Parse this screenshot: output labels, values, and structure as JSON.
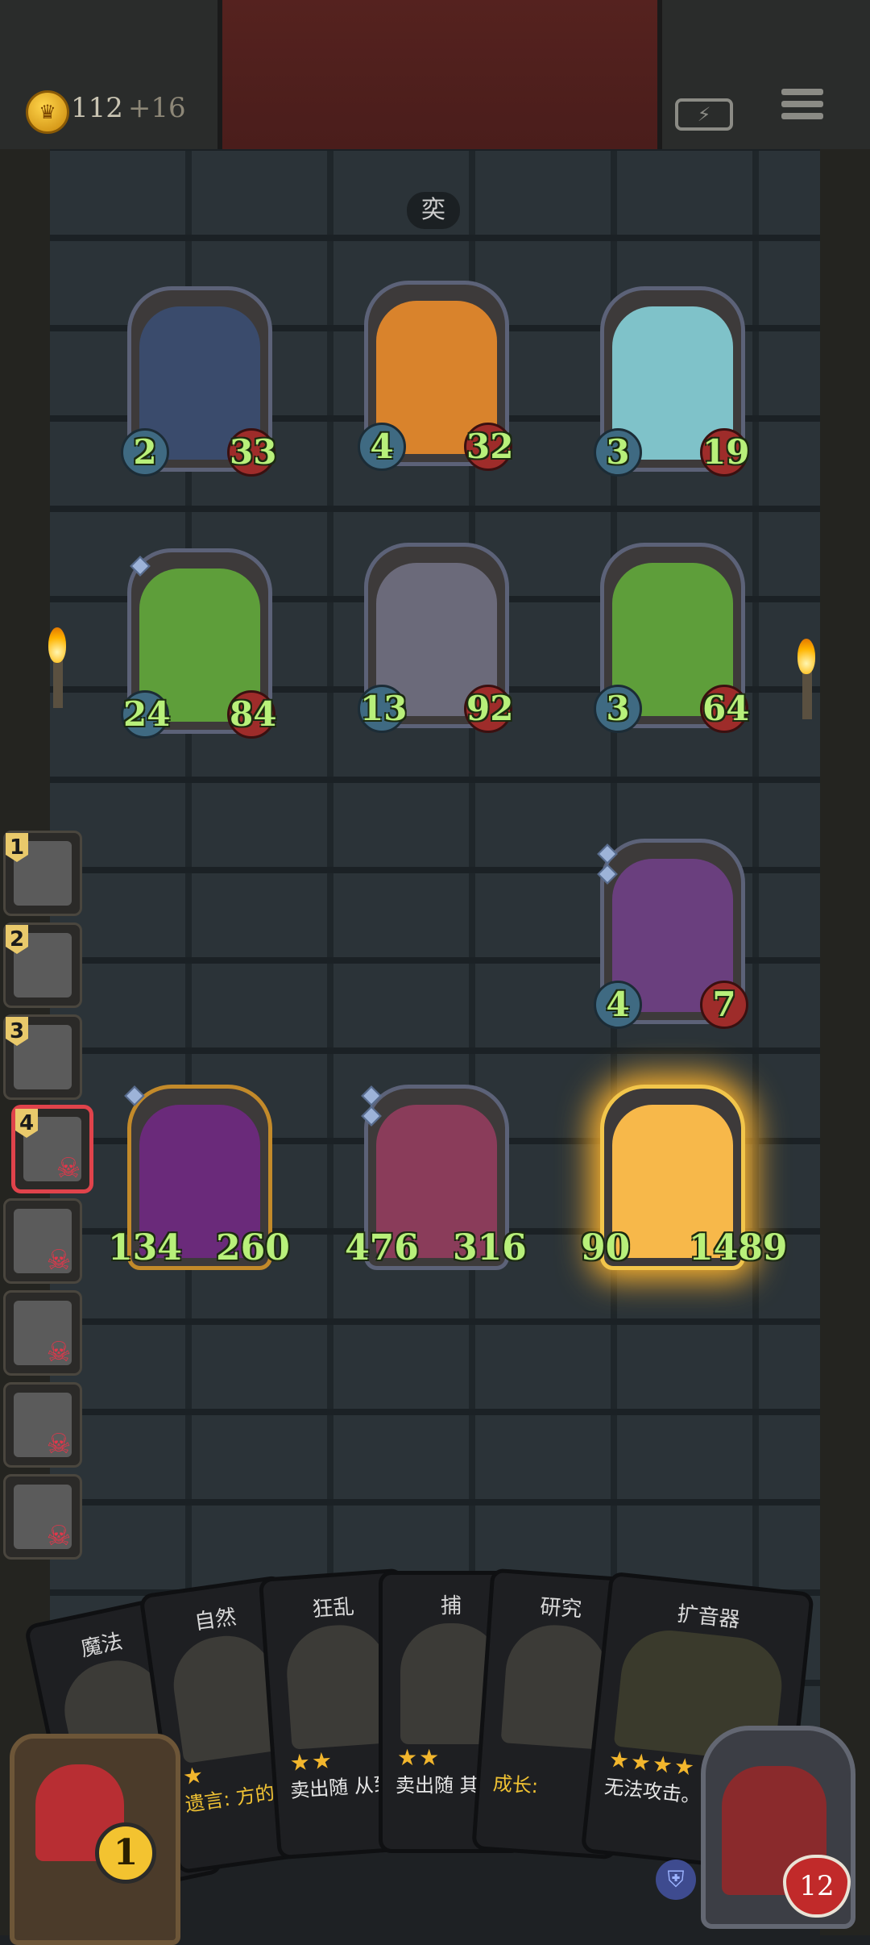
{
  "header": {
    "coins": "112",
    "coin_income": "+16",
    "coin_icon": "crown-coin-icon",
    "battery_icon": "battery-charging-icon",
    "menu_icon": "menu-icon"
  },
  "round_label": "奕",
  "board": {
    "units": [
      {
        "name": "elf-sorceress",
        "atk": "2",
        "hp": "33",
        "color": "#3a4b6c"
      },
      {
        "name": "pumpkin-ghost",
        "atk": "4",
        "hp": "32",
        "color": "#d9832c"
      },
      {
        "name": "fairy",
        "atk": "3",
        "hp": "19",
        "color": "#7fc2c9"
      },
      {
        "name": "leaf-sprout",
        "atk": "24",
        "hp": "84",
        "color": "#5e9e3a"
      },
      {
        "name": "mushroom-beast",
        "atk": "13",
        "hp": "92",
        "color": "#6b6a7a"
      },
      {
        "name": "leaf-sprout",
        "atk": "3",
        "hp": "64",
        "color": "#5e9e3a"
      },
      {
        "name": "elf-sorceress",
        "atk": "4",
        "hp": "7",
        "color": "#6a3f7e"
      },
      {
        "name": "jester-clown",
        "atk": "134",
        "hp": "260",
        "color": "#6a2a7a"
      },
      {
        "name": "grinning-imp",
        "atk": "476",
        "hp": "316",
        "color": "#8a3c5a"
      },
      {
        "name": "glowing-sprout",
        "atk": "90",
        "hp": "1489",
        "color": "#f7b84a"
      }
    ]
  },
  "opponents": [
    {
      "rank": "1",
      "status": "alive"
    },
    {
      "rank": "2",
      "status": "alive"
    },
    {
      "rank": "3",
      "status": "alive"
    },
    {
      "rank": "4",
      "status": "eliminated"
    },
    {
      "rank": "",
      "status": "eliminated"
    },
    {
      "rank": "",
      "status": "eliminated"
    },
    {
      "rank": "",
      "status": "eliminated"
    },
    {
      "rank": "",
      "status": "eliminated"
    }
  ],
  "hand": [
    {
      "title": "魔法",
      "stars": "",
      "desc": ""
    },
    {
      "title": "自然",
      "stars": "★",
      "desc": "遗言: 方的",
      "kw": "遗言"
    },
    {
      "title": "狂乱",
      "stars": "★★",
      "desc": "卖出随 从到",
      "kw": ""
    },
    {
      "title": "捕",
      "stars": "★★",
      "desc": "卖出随 其一",
      "kw": ""
    },
    {
      "title": "研究",
      "stars": "",
      "desc": "成长:",
      "kw": "成长"
    },
    {
      "title": "扩音器",
      "stars": "★★★★",
      "desc": "无法攻击。 攻击时,",
      "kw": ""
    }
  ],
  "gift": {
    "cost": "1",
    "icon": "gift-box-icon"
  },
  "player": {
    "hp": "12",
    "shield_icon": "shield-icon"
  }
}
